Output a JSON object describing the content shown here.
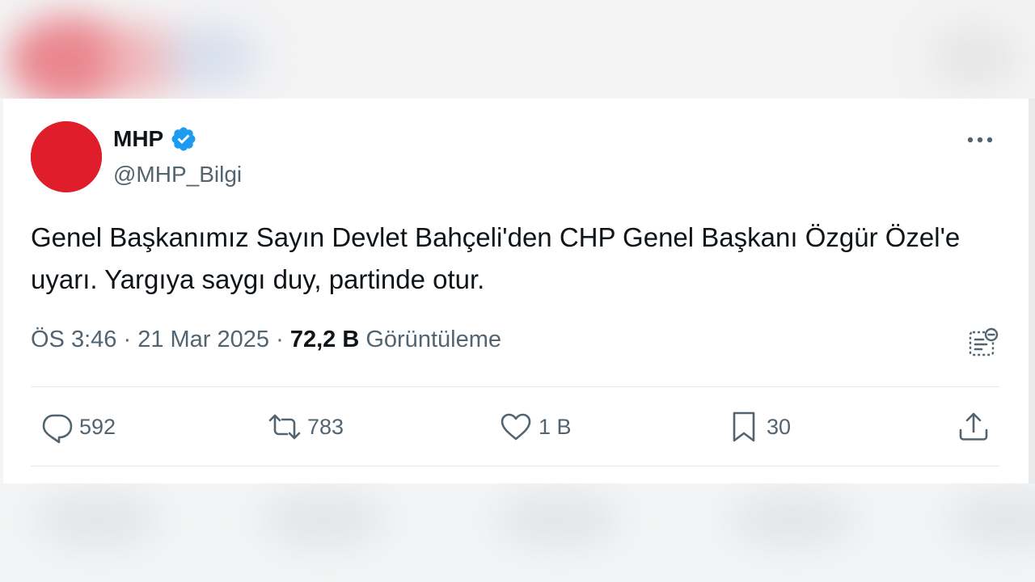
{
  "tweet": {
    "author": {
      "name": "MHP",
      "handle": "@MHP_Bilgi",
      "avatar_icon": "mhp-crescents-logo",
      "verified_icon": "verified-badge-icon",
      "verified_color": "#1d9bf0"
    },
    "text": "Genel Başkanımız Sayın Devlet Bahçeli'den CHP Genel Başkanı Özgür Özel'e uyarı. Yargıya saygı duy, partinde otur.",
    "meta": {
      "time": "ÖS 3:46",
      "separator": "·",
      "date": "21 Mar 2025",
      "views_count": "72,2 B",
      "views_label": "Görüntüleme"
    },
    "actions": {
      "reply_count": "592",
      "retweet_count": "783",
      "like_count": "1 B",
      "bookmark_count": "30"
    }
  },
  "colors": {
    "accent_red": "#e01e2b",
    "muted_text": "#536471",
    "primary_text": "#0f1419"
  }
}
